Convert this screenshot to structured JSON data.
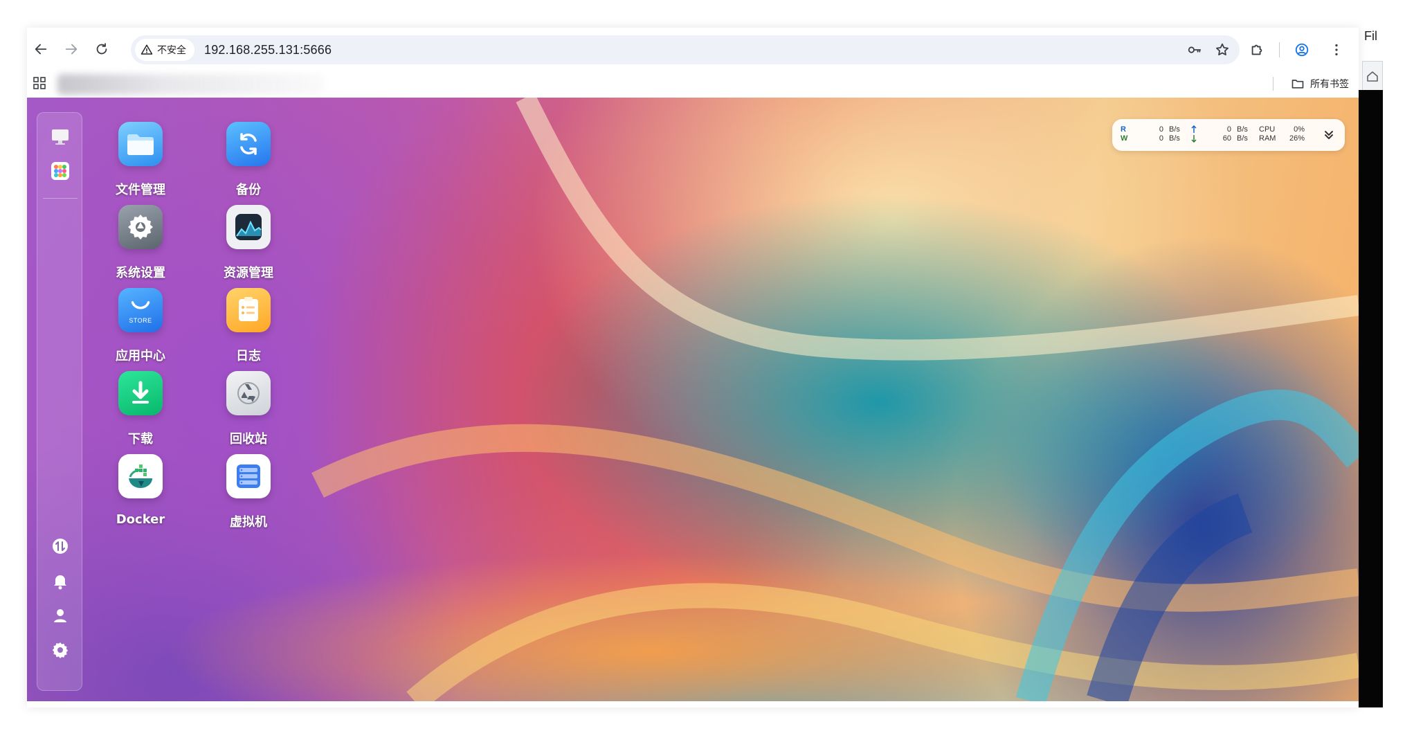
{
  "browser": {
    "security_label": "不安全",
    "url": "192.168.255.131:5666",
    "all_bookmarks": "所有书签"
  },
  "desktop_apps": [
    {
      "label": "文件管理",
      "icon": "folder-icon"
    },
    {
      "label": "备份",
      "icon": "backup-icon"
    },
    {
      "label": "系统设置",
      "icon": "gear-icon"
    },
    {
      "label": "资源管理",
      "icon": "activity-monitor-icon"
    },
    {
      "label": "应用中心",
      "icon": "store-icon",
      "badge": "STORE"
    },
    {
      "label": "日志",
      "icon": "log-icon"
    },
    {
      "label": "下载",
      "icon": "download-icon"
    },
    {
      "label": "回收站",
      "icon": "recycle-bin-icon"
    },
    {
      "label": "Docker",
      "icon": "docker-icon"
    },
    {
      "label": "虚拟机",
      "icon": "virtual-machine-icon"
    }
  ],
  "monitor": {
    "read_label": "R",
    "write_label": "W",
    "read_value": "0",
    "write_value": "0",
    "unit": "B/s",
    "upload_value": "0",
    "download_value": "60",
    "cpu_label": "CPU",
    "cpu_value": "0%",
    "ram_label": "RAM",
    "ram_value": "26%"
  },
  "side_panel": {
    "partial_text": "Fil"
  },
  "colors": {
    "read": "#1565c0",
    "write": "#2e7d32",
    "upload": "#1565c0",
    "download": "#2e7d32"
  }
}
